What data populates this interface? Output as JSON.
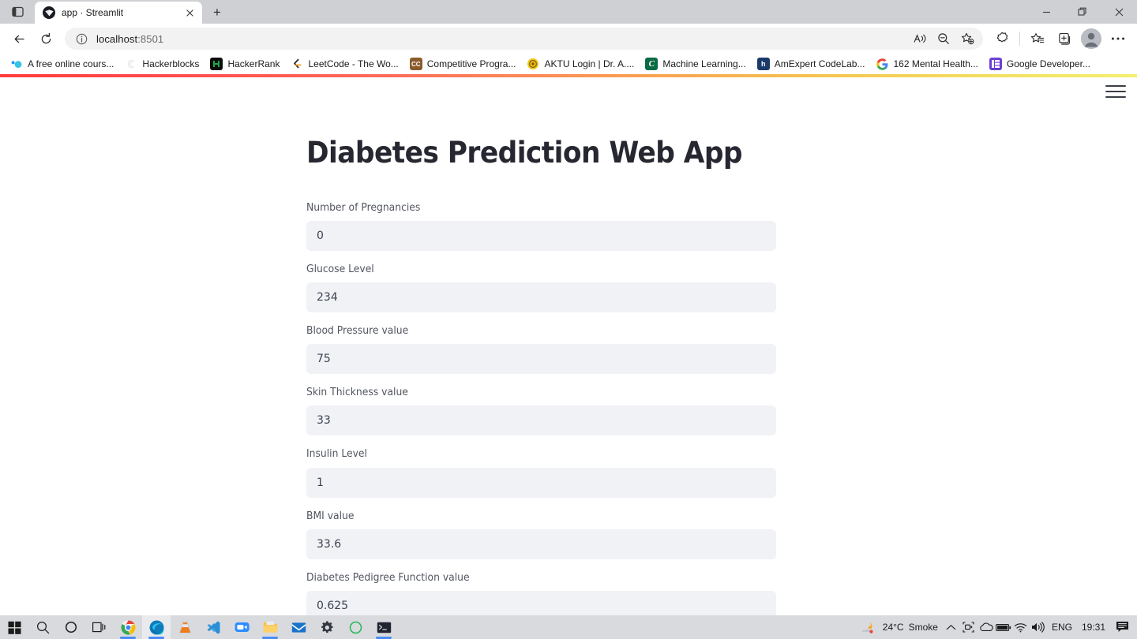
{
  "browser": {
    "tab": {
      "title": "app · Streamlit",
      "favicon_icon": "streamlit-favicon",
      "close_icon": "close-icon"
    },
    "tab_search_icon": "tab-search-icon",
    "newtab_label": "+",
    "window_controls": {
      "minimize_icon": "minimize-icon",
      "restore_icon": "restore-icon",
      "close_icon": "close-window-icon"
    },
    "toolbar": {
      "back_icon": "back-arrow-icon",
      "refresh_icon": "refresh-icon",
      "info_icon": "site-info-icon",
      "url_host": "localhost",
      "url_port": ":8501",
      "read_aloud_icon": "read-aloud-icon",
      "zoom_out_icon": "zoom-out-icon",
      "add_favorite_icon": "add-favorite-icon",
      "copilot_icon": "copilot-icon",
      "favorites_icon": "favorites-icon",
      "collections_icon": "collections-icon",
      "profile_icon": "profile-avatar-icon",
      "settings_icon": "settings-ellipsis-icon"
    },
    "bookmarks": [
      {
        "label": "A free online cours...",
        "icon": "dots-blue-icon",
        "color": "#3ec6e0"
      },
      {
        "label": "Hackerblocks",
        "icon": "hackerblocks-icon",
        "color": "#f5f7f9"
      },
      {
        "label": "HackerRank",
        "icon": "hackerrank-icon",
        "color": "#0d0d0d"
      },
      {
        "label": "LeetCode - The Wo...",
        "icon": "leetcode-icon",
        "color": "#ffa116"
      },
      {
        "label": "Competitive Progra...",
        "icon": "cc-icon",
        "color": "#8a5a2b"
      },
      {
        "label": "AKTU Login | Dr. A....",
        "icon": "aktu-icon",
        "color": "#f0c419"
      },
      {
        "label": "Machine Learning...",
        "icon": "coursera-c-icon",
        "color": "#0b6b45"
      },
      {
        "label": "AmExpert CodeLab...",
        "icon": "amexpert-icon",
        "color": "#1a3a6b"
      },
      {
        "label": "162 Mental Health...",
        "icon": "google-g-icon",
        "color": "#ffffff"
      },
      {
        "label": "Google Developer...",
        "icon": "google-dev-icon",
        "color": "#6b3fd6"
      }
    ]
  },
  "app": {
    "menu_icon": "hamburger-menu-icon",
    "title": "Diabetes Prediction Web App",
    "fields": [
      {
        "label": "Number of Pregnancies",
        "value": "0",
        "name": "pregnancies"
      },
      {
        "label": "Glucose Level",
        "value": "234",
        "name": "glucose"
      },
      {
        "label": "Blood Pressure value",
        "value": "75",
        "name": "blood-pressure"
      },
      {
        "label": "Skin Thickness value",
        "value": "33",
        "name": "skin-thickness"
      },
      {
        "label": "Insulin Level",
        "value": "1",
        "name": "insulin"
      },
      {
        "label": "BMI value",
        "value": "33.6",
        "name": "bmi"
      },
      {
        "label": "Diabetes Pedigree Function value",
        "value": "0.625",
        "name": "pedigree"
      }
    ],
    "progress_colors": {
      "start": "#ff3c3c",
      "end": "#f5ef6e"
    }
  },
  "taskbar": {
    "items": [
      {
        "name": "start-button",
        "icon": "windows-start-icon"
      },
      {
        "name": "search-button",
        "icon": "search-icon"
      },
      {
        "name": "cortana-button",
        "icon": "cortana-circle-icon"
      },
      {
        "name": "task-view-button",
        "icon": "task-view-icon"
      },
      {
        "name": "chrome-app",
        "icon": "chrome-icon",
        "running": true
      },
      {
        "name": "edge-app",
        "icon": "edge-icon",
        "running": true,
        "active": true
      },
      {
        "name": "vlc-app",
        "icon": "vlc-cone-icon",
        "running": false
      },
      {
        "name": "vscode-app",
        "icon": "vscode-icon",
        "running": false
      },
      {
        "name": "zoom-app",
        "icon": "zoom-camera-icon",
        "running": false
      },
      {
        "name": "file-explorer-app",
        "icon": "folder-icon",
        "running": true
      },
      {
        "name": "mail-app",
        "icon": "mail-envelope-icon",
        "running": false
      },
      {
        "name": "settings-app",
        "icon": "gear-icon",
        "running": false
      },
      {
        "name": "spotify-app",
        "icon": "green-circle-icon",
        "running": false
      },
      {
        "name": "terminal-app",
        "icon": "terminal-icon",
        "running": true
      }
    ],
    "tray": {
      "weather_temp": "24°C",
      "weather_condition": "Smoke",
      "weather_icon": "smoke-weather-icon",
      "chevron_icon": "chevron-up-icon",
      "screen_capture_icon": "screen-capture-icon",
      "onedrive_icon": "onedrive-cloud-icon",
      "battery_icon": "battery-icon",
      "wifi_icon": "wifi-icon",
      "volume_icon": "speaker-icon",
      "language": "ENG",
      "time": "19:31",
      "notifications_icon": "notifications-icon"
    }
  }
}
